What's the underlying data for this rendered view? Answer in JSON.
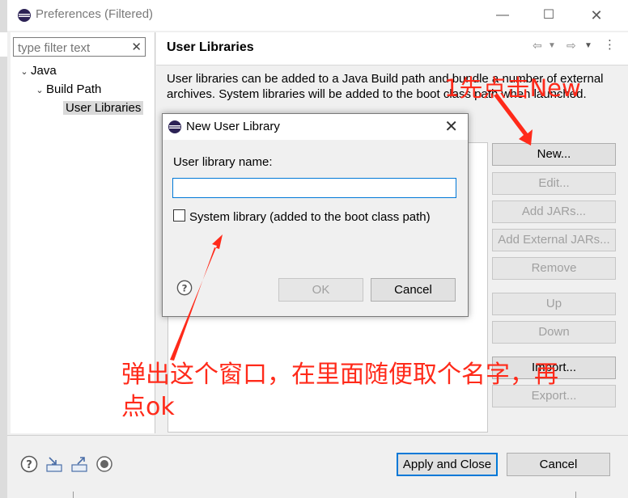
{
  "window": {
    "title": "Preferences (Filtered)",
    "controls": [
      "minimize",
      "maximize",
      "close"
    ]
  },
  "filter": {
    "placeholder": "type filter text",
    "value": ""
  },
  "tree": {
    "items": [
      {
        "label": "Java",
        "expanded": true
      },
      {
        "label": "Build Path",
        "expanded": true
      },
      {
        "label": "User Libraries",
        "selected": true
      }
    ]
  },
  "page": {
    "title": "User Libraries",
    "description": "User libraries can be added to a Java Build path and bundle a number of external archives. System libraries will be added to the boot class path when launched.",
    "buttons": [
      {
        "label": "New...",
        "enabled": true
      },
      {
        "label": "Edit...",
        "enabled": false
      },
      {
        "label": "Add JARs...",
        "enabled": false
      },
      {
        "label": "Add External JARs...",
        "enabled": false
      },
      {
        "label": "Remove",
        "enabled": false
      },
      {
        "label": "Up",
        "enabled": false
      },
      {
        "label": "Down",
        "enabled": false
      },
      {
        "label": "Import...",
        "enabled": true
      },
      {
        "label": "Export...",
        "enabled": false
      }
    ]
  },
  "bottom": {
    "apply_close_label": "Apply and Close",
    "cancel_label": "Cancel",
    "icons": [
      "help-icon",
      "import-icon",
      "export-icon",
      "record-icon"
    ]
  },
  "dialog": {
    "title": "New User Library",
    "name_label": "User library name:",
    "name_value": "",
    "system_checkbox_label": "System library (added to the boot class path)",
    "system_checked": false,
    "ok_label": "OK",
    "ok_enabled": false,
    "cancel_label": "Cancel"
  },
  "annotations": {
    "note1": "1先点击New",
    "note2_line1": "弹出这个窗口，在里面随便取个名字，再",
    "note2_line2": "点ok",
    "color": "#ff2a1a"
  },
  "colors": {
    "accent": "#0078d7",
    "selected_bg": "#d9d9d9",
    "annotation": "#ff2a1a"
  }
}
